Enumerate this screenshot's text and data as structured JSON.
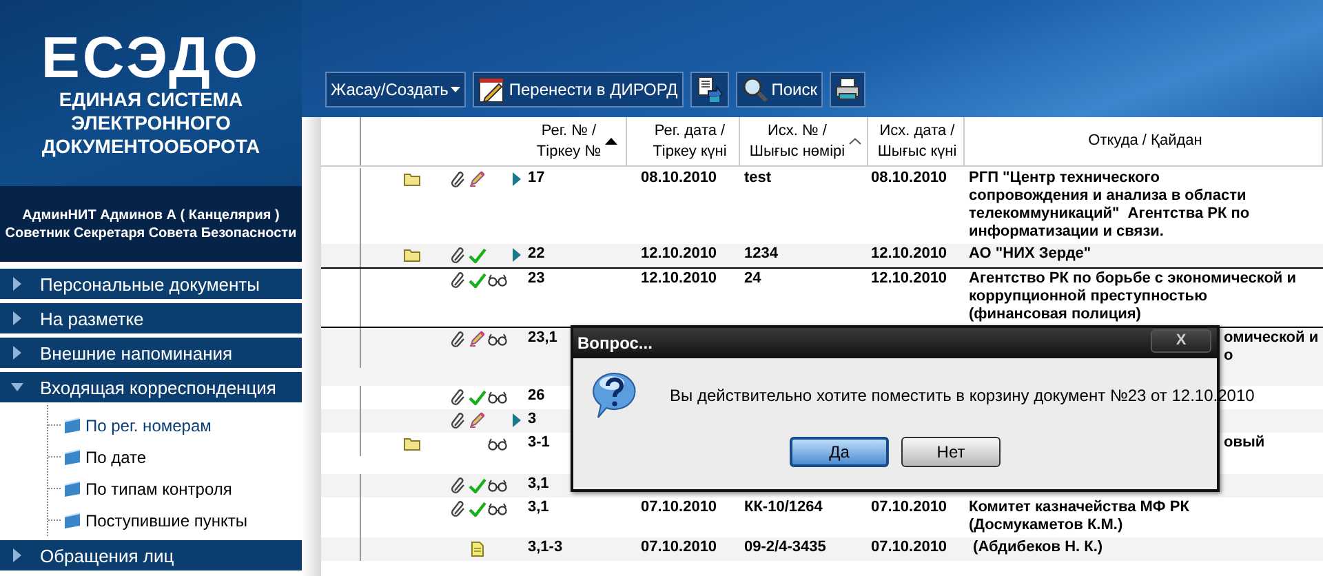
{
  "logo": {
    "title": "ЕСЭДО",
    "subtitle_lines": [
      "ЕДИНАЯ СИСТЕМА",
      "ЭЛЕКТРОННОГО",
      "ДОКУМЕНТООБОРОТА"
    ]
  },
  "user": {
    "name": "АдминНИТ Админов А ( Канцелярия )",
    "position": "Советник Секретаря Совета Безопасности"
  },
  "sidebar": {
    "items": [
      {
        "label": "Персональные документы",
        "expanded": false
      },
      {
        "label": "На разметке",
        "expanded": false
      },
      {
        "label": "Внешние напоминания",
        "expanded": false
      },
      {
        "label": "Входящая корреспонденция",
        "expanded": true,
        "children": [
          {
            "label": "По рег. номерам",
            "selected": true
          },
          {
            "label": "По дате",
            "selected": false
          },
          {
            "label": "По типам контроля",
            "selected": false
          },
          {
            "label": "Поступившие пункты",
            "selected": false
          }
        ]
      },
      {
        "label": "Обращения лиц",
        "expanded": false
      }
    ]
  },
  "toolbar": [
    {
      "kind": "menu",
      "label": "Жасау/Создать"
    },
    {
      "kind": "transfer",
      "label": "Перенести в ДИРОРД"
    },
    {
      "kind": "export"
    },
    {
      "kind": "search",
      "label": "Поиск"
    },
    {
      "kind": "print"
    }
  ],
  "table": {
    "columns": [
      {
        "lines": [
          "Рег. № /",
          "Тіркеу №"
        ],
        "sorted": true
      },
      {
        "lines": [
          "Рег. дата /",
          "Тіркеу күні"
        ]
      },
      {
        "lines": [
          "Исх. № /",
          "Шығыс нөмірі"
        ],
        "sort_hint": true
      },
      {
        "lines": [
          "Исх. дата /",
          "Шығыс күні"
        ]
      },
      {
        "lines": [
          "Откуда / Қайдан"
        ]
      }
    ],
    "rows": [
      {
        "icons": [
          {
            "kind": "folder"
          },
          {
            "kind": "attachment"
          },
          {
            "kind": "draft"
          },
          {
            "kind": "expand"
          }
        ],
        "selected": false,
        "reg_no": "17",
        "reg_date": "08.10.2010",
        "out_no": "test",
        "out_date": "08.10.2010",
        "from_lines": [
          "РГП \"Центр технического",
          "сопровождения и анализа в области",
          "телекоммуникаций\"  Агентства РК по",
          "информатизации и связи."
        ]
      },
      {
        "icons": [
          {
            "kind": "folder"
          },
          {
            "kind": "attachment"
          },
          {
            "kind": "approved"
          },
          {
            "kind": "expand"
          }
        ],
        "selected": false,
        "reg_no": "22",
        "reg_date": "12.10.2010",
        "out_no": "1234",
        "out_date": "12.10.2010",
        "from_lines": [
          "АО \"НИХ Зерде\""
        ]
      },
      {
        "icons": [
          {
            "kind": "attachment"
          },
          {
            "kind": "approved"
          },
          {
            "kind": "viewed"
          }
        ],
        "selected": true,
        "reg_no": "23",
        "reg_date": "12.10.2010",
        "out_no": "24",
        "out_date": "12.10.2010",
        "from_lines": [
          "Агентство РК по борьбе с экономической и",
          "коррупционной преступностью",
          "(финансовая полиция)"
        ]
      },
      {
        "icons": [
          {
            "kind": "attachment"
          },
          {
            "kind": "draft"
          },
          {
            "kind": "viewed"
          }
        ],
        "selected": false,
        "reg_no": "23,1",
        "from_visible": [
          "омической и",
          "о"
        ]
      },
      {
        "icons": [
          {
            "kind": "attachment"
          },
          {
            "kind": "approved"
          },
          {
            "kind": "viewed"
          }
        ],
        "selected": false,
        "reg_no": "26"
      },
      {
        "icons": [
          {
            "kind": "attachment"
          },
          {
            "kind": "draft"
          },
          {
            "kind": "expand"
          }
        ],
        "selected": false,
        "reg_no": "3"
      },
      {
        "icons": [
          {
            "kind": "folder"
          },
          {
            "kind": "viewed"
          }
        ],
        "selected": false,
        "reg_no": "3-1",
        "from_visible": [
          "овый"
        ]
      },
      {
        "icons": [
          {
            "kind": "attachment"
          },
          {
            "kind": "approved"
          },
          {
            "kind": "viewed"
          }
        ],
        "selected": false,
        "reg_no": "3,1"
      },
      {
        "icons": [
          {
            "kind": "attachment"
          },
          {
            "kind": "approved"
          },
          {
            "kind": "viewed"
          }
        ],
        "selected": false,
        "reg_no": "3,1",
        "reg_date": "07.10.2010",
        "out_no": "КК-10/1264",
        "out_date": "07.10.2010",
        "from_lines": [
          "Комитет казначейства МФ РК",
          "(Досмукаметов К.М.)"
        ]
      },
      {
        "icons": [
          {
            "kind": "document"
          }
        ],
        "selected": false,
        "reg_no": "3,1-3",
        "reg_date": "07.10.2010",
        "out_no": "09-2/4-3435",
        "out_date": "07.10.2010",
        "from_lines": [
          " (Абдибеков Н. К.)"
        ]
      }
    ]
  },
  "dialog": {
    "title": "Вопрос...",
    "close": "X",
    "message": "Вы действительно хотите поместить в корзину документ №23 от 12.10.2010",
    "buttons": [
      {
        "label": "Да",
        "selected": true
      },
      {
        "label": "Нет",
        "selected": false
      }
    ]
  }
}
